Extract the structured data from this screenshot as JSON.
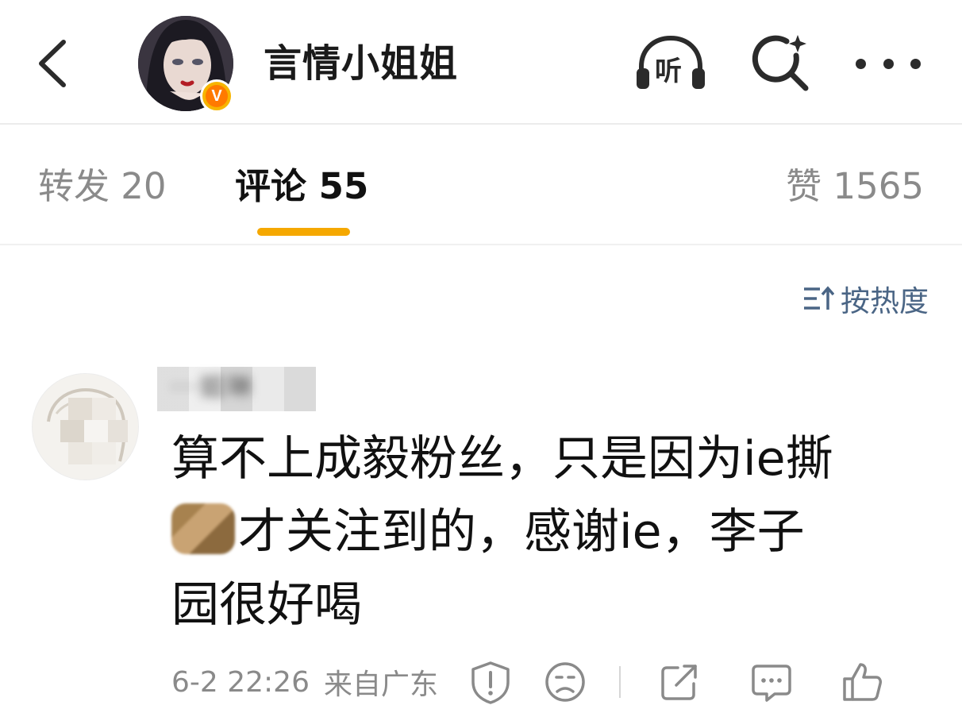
{
  "header": {
    "title": "言情小姐姐",
    "listen_label": "听",
    "icons": [
      "back-arrow-icon",
      "avatar",
      "verified-badge-icon",
      "listen-headphone-icon",
      "ai-search-icon",
      "more-icon"
    ]
  },
  "tabs": [
    {
      "label": "转发 20",
      "active": false
    },
    {
      "label": "评论 55",
      "active": true
    },
    {
      "label": "赞 1565",
      "active": false
    }
  ],
  "sort": {
    "label": "按热度",
    "icon": "sort-icon"
  },
  "comment": {
    "username": "···姐琳",
    "text_line1": "算不上成毅粉丝，只是因为ie撕",
    "text_line2": "才关注到的，感谢ie，李子",
    "text_line3": "园很好喝",
    "timestamp": "6-2 22:26",
    "location": "来自广东",
    "icons": [
      "report-icon",
      "dislike-face-icon",
      "share-icon",
      "reply-icon",
      "like-icon"
    ]
  },
  "colors": {
    "accent": "#f5a800",
    "sort_text": "#4a6585",
    "muted": "#8a8a8a"
  }
}
